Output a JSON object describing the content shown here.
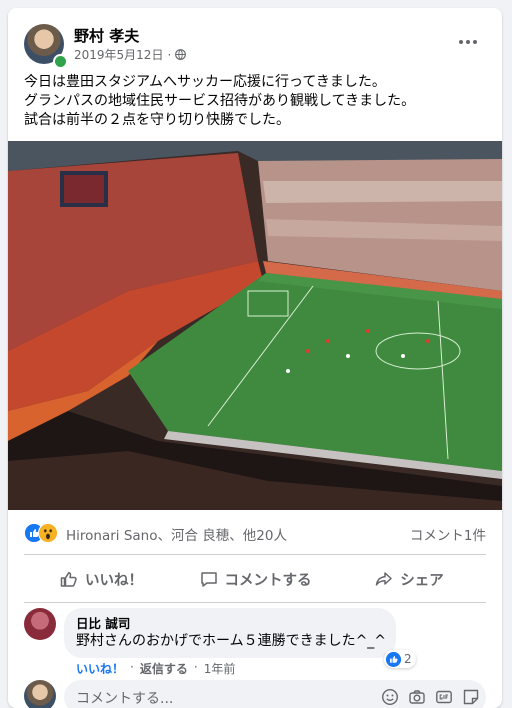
{
  "post": {
    "author": "野村 孝夫",
    "date": "2019年5月12日",
    "separator": "·",
    "lines": [
      "今日は豊田スタジアムへサッカー応援に行ってきました。",
      "グランパスの地域住民サービス招待があり観戦してきました。",
      "試合は前半の２点を守り切り快勝でした。"
    ]
  },
  "reactions": {
    "names": "Hironari Sano、河合 良穂、他20人",
    "comments": "コメント1件"
  },
  "actions": {
    "like": "いいね！",
    "comment": "コメントする",
    "share": "シェア"
  },
  "comment": {
    "name": "日比 誠司",
    "text": "野村さんのおかげでホーム５連勝できました^_^",
    "like": "いいね！",
    "reply": "返信する",
    "time": "1年前",
    "like_count": "2",
    "dot": "·"
  },
  "composer": {
    "placeholder": "コメントする..."
  },
  "colors": {
    "accent": "#1877f2",
    "secondary_text": "#65676b",
    "online": "#31a24c",
    "wow": "#f7b125"
  }
}
